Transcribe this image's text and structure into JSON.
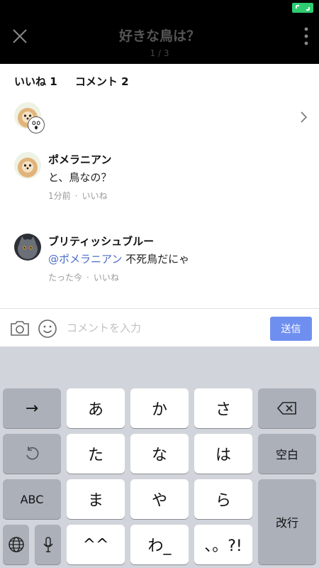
{
  "header": {
    "title": "好きな鳥は？",
    "page_counter": "1 / 3"
  },
  "tabs": {
    "likes": "いいね 1",
    "comments": "コメント 2"
  },
  "comments": [
    {
      "author": "ポメラニアン",
      "text": "と、鳥なの？",
      "time": "1分前",
      "like_label": "いいね"
    },
    {
      "author": "ブリティッシュブルー",
      "mention": "@ポメラニアン",
      "text": " 不死鳥だにゃ",
      "time": "たった今",
      "like_label": "いいね"
    }
  ],
  "input_bar": {
    "placeholder": "コメントを入力",
    "send_label": "送信"
  },
  "keyboard": {
    "row1": [
      "→",
      "あ",
      "か",
      "さ"
    ],
    "row2": [
      "た",
      "な",
      "は",
      "空白"
    ],
    "row3": [
      "ABC",
      "ま",
      "や",
      "ら",
      "改行"
    ],
    "row4": [
      "^^",
      "わ_",
      "、。?!"
    ]
  },
  "colors": {
    "header_bg": "#000000",
    "send_button": "#6f8ff0",
    "mention": "#4a6cc7",
    "keyboard_bg": "#d1d4da"
  }
}
